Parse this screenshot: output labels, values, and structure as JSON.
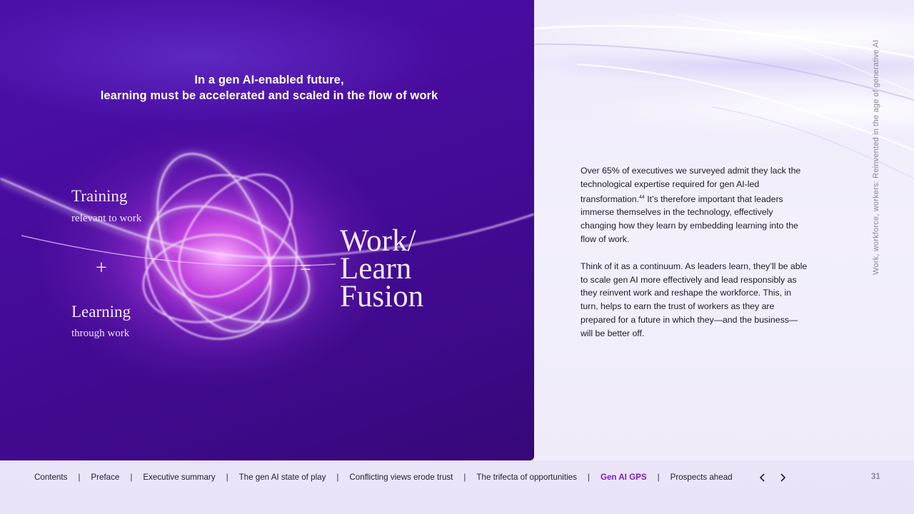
{
  "hero": {
    "title_line1": "In a gen AI-enabled future,",
    "title_line2": "learning must be accelerated and scaled in the flow of work",
    "training_heading": "Training",
    "training_sub": "relevant to work",
    "plus": "+",
    "learning_heading": "Learning",
    "learning_sub": "through work",
    "equals": "=",
    "fusion_line1": "Work/",
    "fusion_line2": "Learn",
    "fusion_line3": "Fusion"
  },
  "copy": {
    "para1_a": "Over 65% of executives we surveyed admit they lack the technological expertise required for gen AI-led transformation.",
    "para1_ref": "44",
    "para1_b": " It’s therefore important that leaders immerse themselves in the technology, effectively changing how they learn by embedding learning into the flow of work.",
    "para2": "Think of it as a continuum. As leaders learn, they’ll be able to scale gen AI more effectively and lead responsibly as they reinvent work and reshape the workforce. This, in turn, helps to earn the trust of workers as they are prepared for a future in which they—and the business—will be better off."
  },
  "running_head": "Work, workforce, workers: Reinvented in the age of generative AI",
  "nav": {
    "items": [
      {
        "label": "Contents"
      },
      {
        "label": "Preface"
      },
      {
        "label": "Executive summary"
      },
      {
        "label": "The gen AI state of play"
      },
      {
        "label": "Conflicting views erode trust"
      },
      {
        "label": "The trifecta of opportunities"
      },
      {
        "label": "Gen AI GPS"
      },
      {
        "label": "Prospects ahead"
      }
    ],
    "separator": "|",
    "prev_icon": "chevron-left-icon",
    "next_icon": "chevron-right-icon",
    "page_number": "31"
  },
  "colors": {
    "hero_bg": "#450c9c",
    "active_nav": "#7a1fc0",
    "body_text": "#1b1b24"
  }
}
